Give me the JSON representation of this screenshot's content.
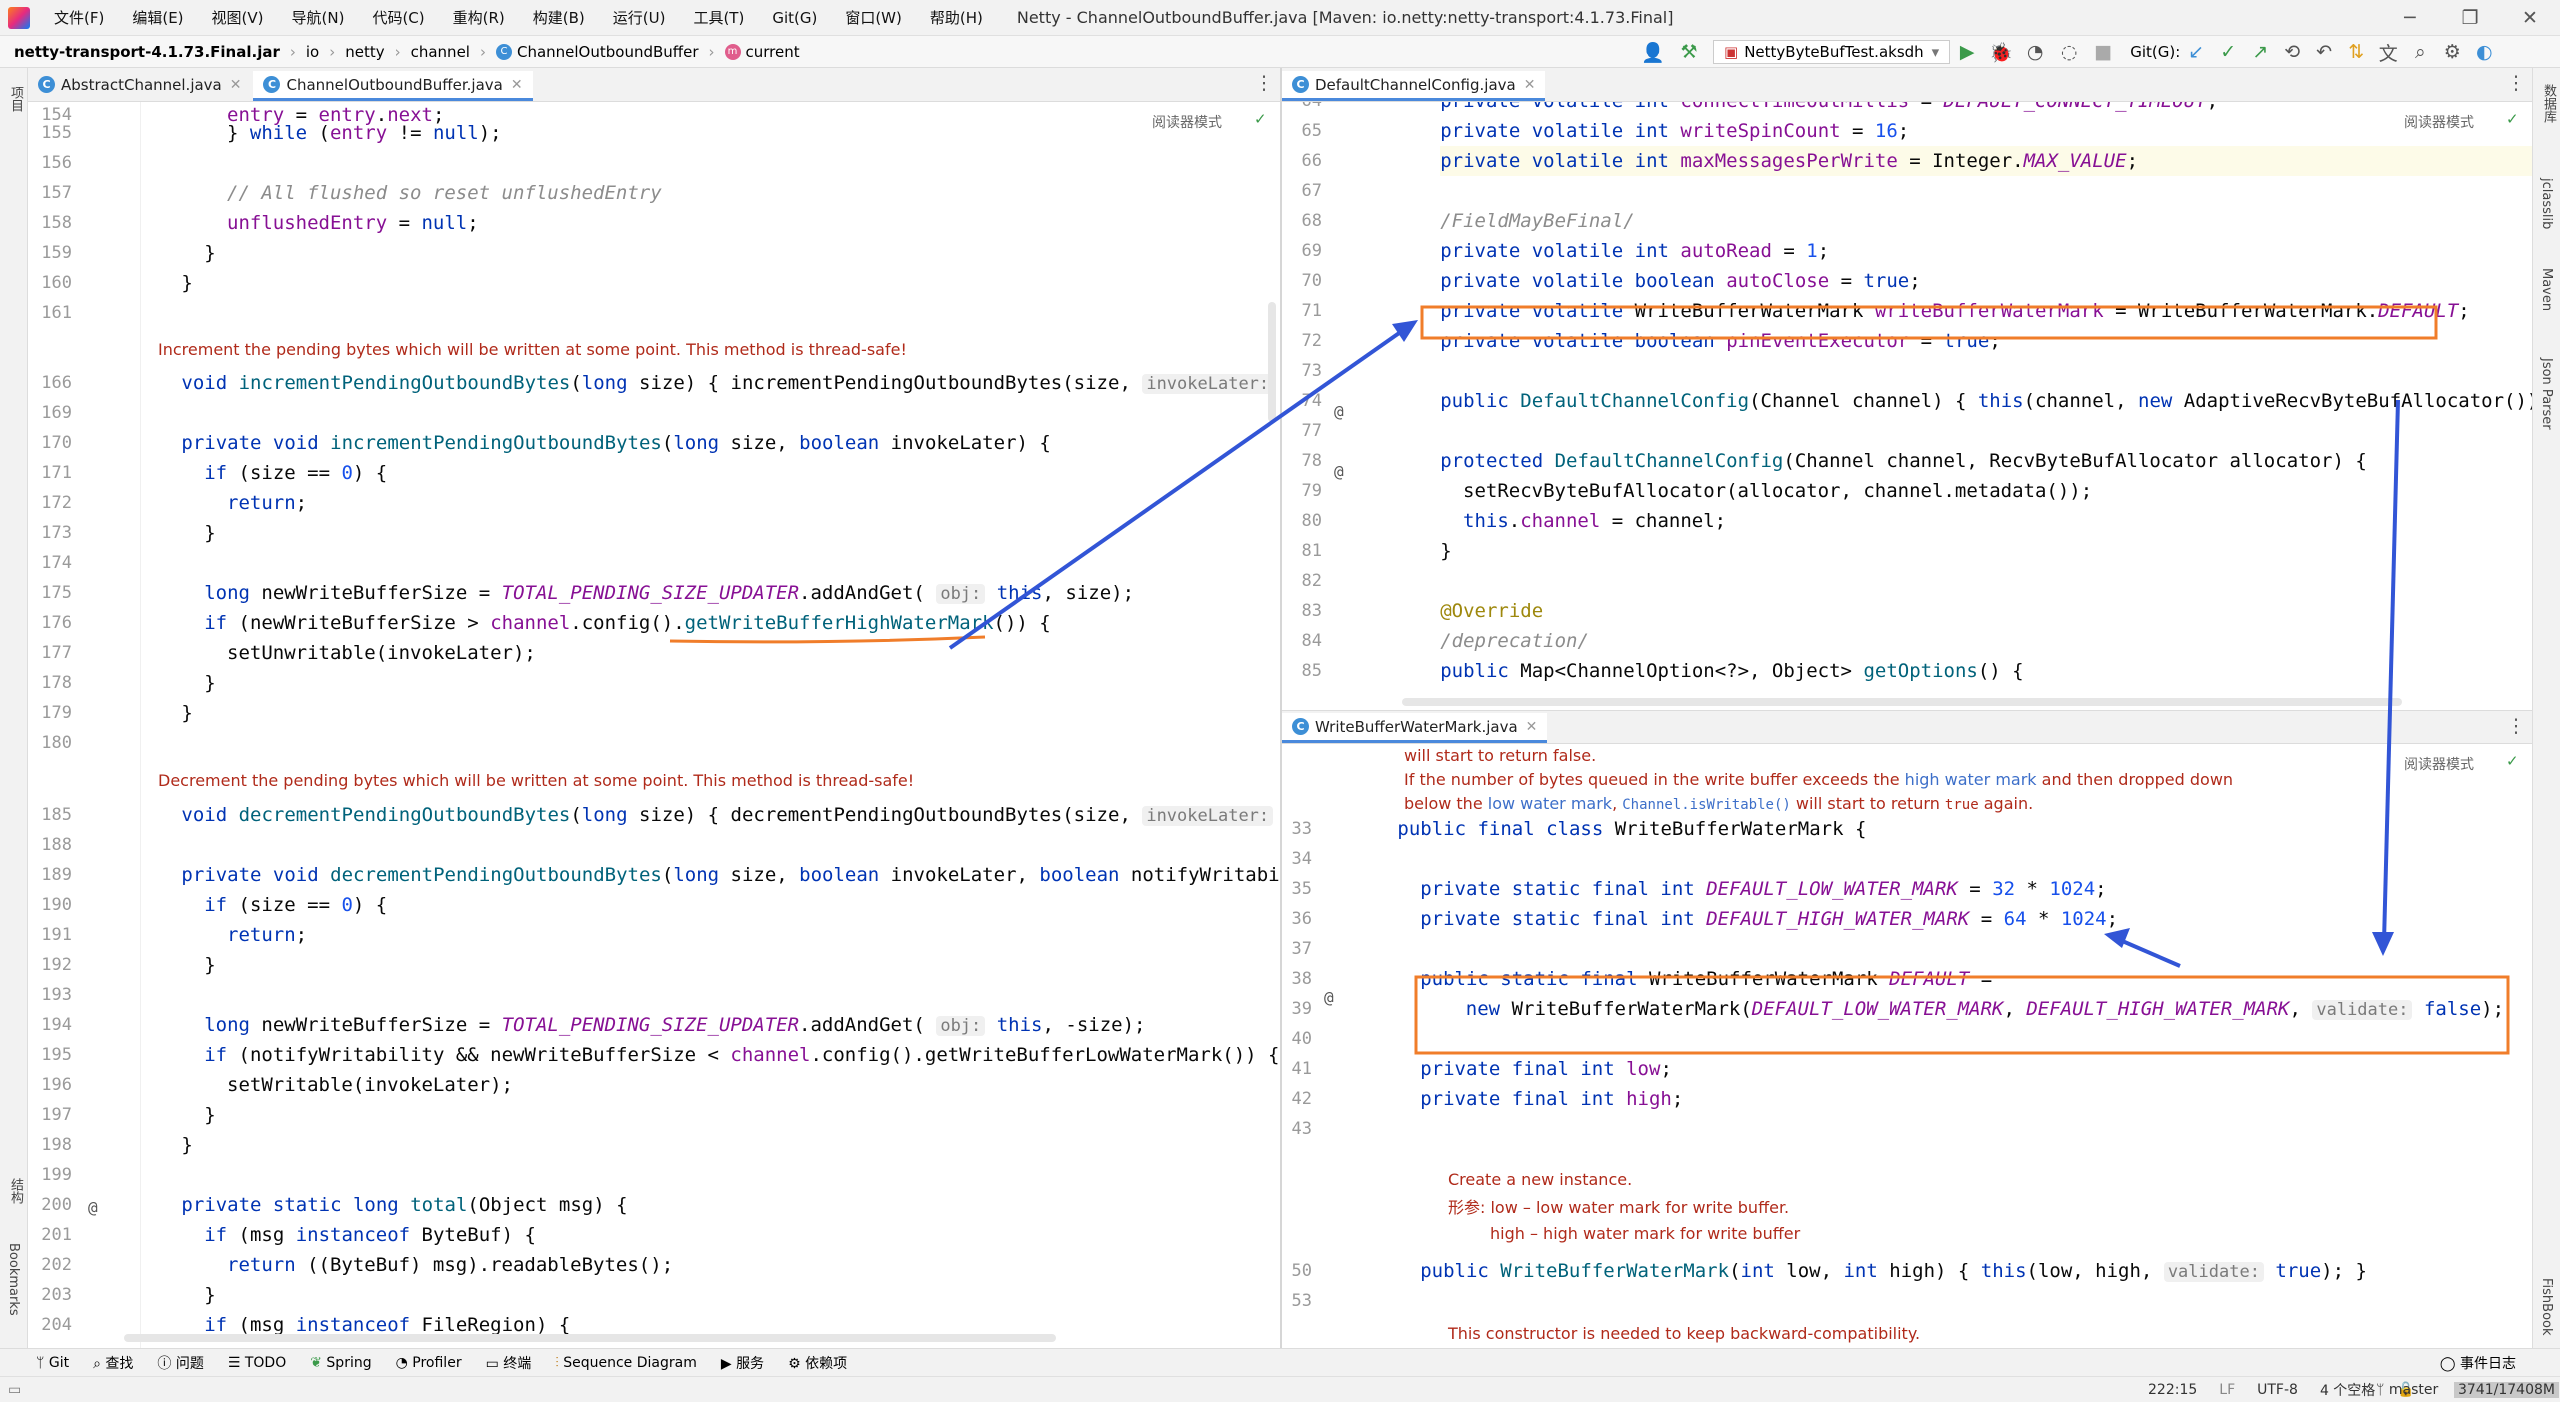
{
  "menu": [
    "文件(F)",
    "编辑(E)",
    "视图(V)",
    "导航(N)",
    "代码(C)",
    "重构(R)",
    "构建(B)",
    "运行(U)",
    "工具(T)",
    "Git(G)",
    "窗口(W)",
    "帮助(H)"
  ],
  "window_title": "Netty - ChannelOutboundBuffer.java [Maven: io.netty:netty-transport:4.1.73.Final]",
  "breadcrumb": {
    "jar": "netty-transport-4.1.73.Final.jar",
    "p1": "io",
    "p2": "netty",
    "p3": "channel",
    "cls": "ChannelOutboundBuffer",
    "member": "current"
  },
  "run_config": "NettyByteBufTest.aksdh",
  "git_label": "Git(G):",
  "left_tabs": [
    {
      "label": "AbstractChannel.java",
      "active": false
    },
    {
      "label": "ChannelOutboundBuffer.java",
      "active": true
    }
  ],
  "right_top_tab": "DefaultChannelConfig.java",
  "right_bottom_tab": "WriteBufferWaterMark.java",
  "reader_mode": "阅读器模式",
  "left_docs": {
    "d1": "Increment the pending bytes which will be written at some point. This method is thread-safe!",
    "d2": "Decrement the pending bytes which will be written at some point. This method is thread-safe!"
  },
  "rb_docs": {
    "top": "will start to return false.",
    "l1a": "If the number of bytes queued in the write buffer exceeds the ",
    "l1b": "high water mark",
    "l1c": " and then dropped down",
    "l2a": "below the ",
    "l2b": "low water mark",
    ", ": "",
    "l2c": "Channel.isWritable()",
    "l2d": " will start to return ",
    "l2e": "true",
    "l2f": " again.",
    "c1": "Create a new instance.",
    "c2a": "形参: ",
    "c2b": "low – low water mark for write buffer.",
    "c3": "high – high water mark for write buffer",
    "c4": "This constructor is needed to keep backward-compatibility."
  },
  "status": {
    "pos": "222:15",
    "lf": "LF",
    "enc": "UTF-8",
    "indent": "4 个空格",
    "branch": "master",
    "mem": "3741/17408M"
  },
  "bottom_tools": [
    "Git",
    "查找",
    "问题",
    "TODO",
    "Spring",
    "Profiler",
    "终端",
    "Sequence Diagram",
    "服务",
    "依赖项"
  ],
  "event_log": "事件日志",
  "left_side": [
    "项目",
    "结构",
    "Bookmarks"
  ],
  "right_side": [
    "数据库",
    "jclasslib",
    "Maven",
    "Json Parser",
    "FishBook"
  ]
}
